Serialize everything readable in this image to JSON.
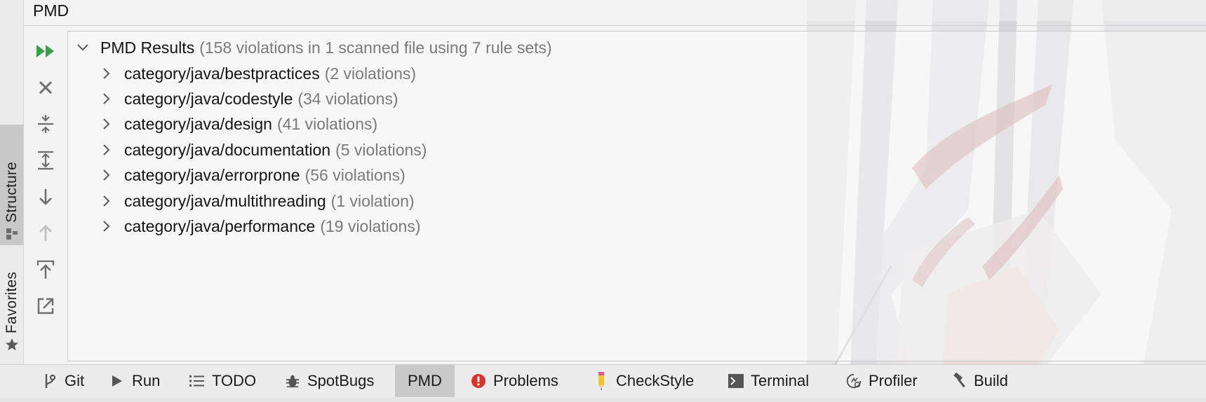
{
  "window": {
    "title": "PMD"
  },
  "sidebar": {
    "items": [
      {
        "label": "Structure",
        "icon": "structure-icon",
        "active": true
      },
      {
        "label": "Favorites",
        "icon": "star-icon",
        "active": false
      }
    ]
  },
  "toolbar": {
    "buttons": [
      {
        "name": "run-all-button",
        "icon": "double-play-icon",
        "enabled": true
      },
      {
        "name": "close-button",
        "icon": "close-icon",
        "enabled": true
      },
      {
        "name": "collapse-all-button",
        "icon": "collapse-all-icon",
        "enabled": true
      },
      {
        "name": "expand-all-button",
        "icon": "expand-all-icon",
        "enabled": true
      },
      {
        "name": "next-button",
        "icon": "arrow-down-icon",
        "enabled": true
      },
      {
        "name": "previous-button",
        "icon": "arrow-up-icon",
        "enabled": false
      },
      {
        "name": "export-button",
        "icon": "export-icon",
        "enabled": true
      },
      {
        "name": "open-external-button",
        "icon": "open-external-icon",
        "enabled": true
      }
    ]
  },
  "results": {
    "root": {
      "label": "PMD Results",
      "summary": "(158 violations in 1 scanned file using 7 rule sets)",
      "expanded": true
    },
    "items": [
      {
        "label": "category/java/bestpractices",
        "count": "(2 violations)"
      },
      {
        "label": "category/java/codestyle",
        "count": "(34 violations)"
      },
      {
        "label": "category/java/design",
        "count": "(41 violations)"
      },
      {
        "label": "category/java/documentation",
        "count": "(5 violations)"
      },
      {
        "label": "category/java/errorprone",
        "count": "(56 violations)"
      },
      {
        "label": "category/java/multithreading",
        "count": "(1 violation)"
      },
      {
        "label": "category/java/performance",
        "count": "(19 violations)"
      }
    ]
  },
  "bottom_tabs": [
    {
      "label": "Git",
      "icon": "git-branch-icon",
      "active": false
    },
    {
      "label": "Run",
      "icon": "play-icon",
      "active": false
    },
    {
      "label": "TODO",
      "icon": "list-icon",
      "active": false
    },
    {
      "label": "SpotBugs",
      "icon": "bug-icon",
      "active": false
    },
    {
      "label": "PMD",
      "icon": "",
      "active": true
    },
    {
      "label": "Problems",
      "icon": "error-icon",
      "active": false
    },
    {
      "label": "CheckStyle",
      "icon": "pencil-icon",
      "active": false
    },
    {
      "label": "Terminal",
      "icon": "terminal-icon",
      "active": false
    },
    {
      "label": "Profiler",
      "icon": "profiler-icon",
      "active": false
    },
    {
      "label": "Build",
      "icon": "hammer-icon",
      "active": false
    }
  ],
  "colors": {
    "run_green": "#3c9e4a",
    "icon_gray": "#6e6e6e",
    "count_gray": "#7a7a7a",
    "error_red": "#d9342b",
    "active_tab": "#c9c9c9"
  }
}
